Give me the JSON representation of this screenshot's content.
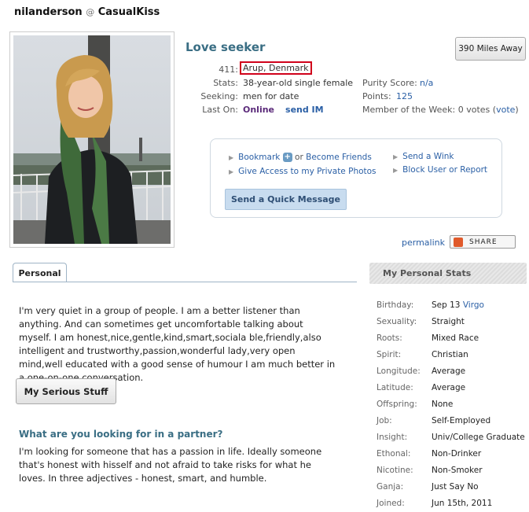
{
  "header": {
    "username": "nilanderson",
    "at": "@",
    "site": "CasualKiss"
  },
  "profile": {
    "title": "Love seeker",
    "distance": "390 Miles Away",
    "location_label": "411:",
    "location": "Arup, Denmark",
    "stats_label": "Stats:",
    "stats": "38-year-old single female",
    "seeking_label": "Seeking:",
    "seeking": "men for date",
    "laston_label": "Last On:",
    "online": "Online",
    "send_im": "send IM",
    "purity_label": "Purity Score:",
    "purity": "n/a",
    "points_label": "Points:",
    "points": "125",
    "member_week_label": "Member of the Week:",
    "member_week_votes": "0 votes (",
    "vote_link": "vote",
    "vote_close": ")"
  },
  "actions": {
    "bookmark": "Bookmark",
    "plus": "+",
    "or_text": "or",
    "become_friends": "Become Friends",
    "send_wink": "Send a Wink",
    "give_access": "Give Access to my Private Photos",
    "block": "Block User or Report",
    "quick_message": "Send a Quick Message"
  },
  "permalink": "permalink",
  "share": "SHARE",
  "tabs": {
    "personal": "Personal"
  },
  "about": "I'm very quiet in a group of people. I am a better listener than anything. And can sometimes get uncomfortable talking about myself. I am honest,nice,gentle,kind,smart,sociala ble,friendly,also intelligent and trustworthy,passion,wonderful lady,very open mind,well educated with a good sense of humour I am much better in a one-on-one conversation.",
  "serious_button": "My Serious Stuff",
  "partner_question": "What are you looking for in a partner?",
  "partner_answer": "I'm looking for someone that has a passion in life. Ideally someone that's honest with hisself and not afraid to take risks for what he loves. In three adjectives - honest, smart, and humble.",
  "personal_stats": {
    "heading": "My Personal Stats",
    "items": [
      {
        "label": "Birthday:",
        "value": "Sep 13",
        "link": "Virgo"
      },
      {
        "label": "Sexuality:",
        "value": "Straight"
      },
      {
        "label": "Roots:",
        "value": "Mixed Race"
      },
      {
        "label": "Spirit:",
        "value": "Christian"
      },
      {
        "label": "Longitude:",
        "value": "Average"
      },
      {
        "label": "Latitude:",
        "value": "Average"
      },
      {
        "label": "Offspring:",
        "value": "None"
      },
      {
        "label": "Job:",
        "value": "Self-Employed"
      },
      {
        "label": "Insight:",
        "value": "Univ/College Graduate"
      },
      {
        "label": "Ethonal:",
        "value": "Non-Drinker"
      },
      {
        "label": "Nicotine:",
        "value": "Non-Smoker"
      },
      {
        "label": "Ganja:",
        "value": "Just Say No"
      },
      {
        "label": "Joined:",
        "value": "Jun 15th, 2011"
      }
    ]
  },
  "colors": {
    "accent": "#3a6e84",
    "link": "#2a5fa5",
    "highlight_box": "#d0021b"
  }
}
